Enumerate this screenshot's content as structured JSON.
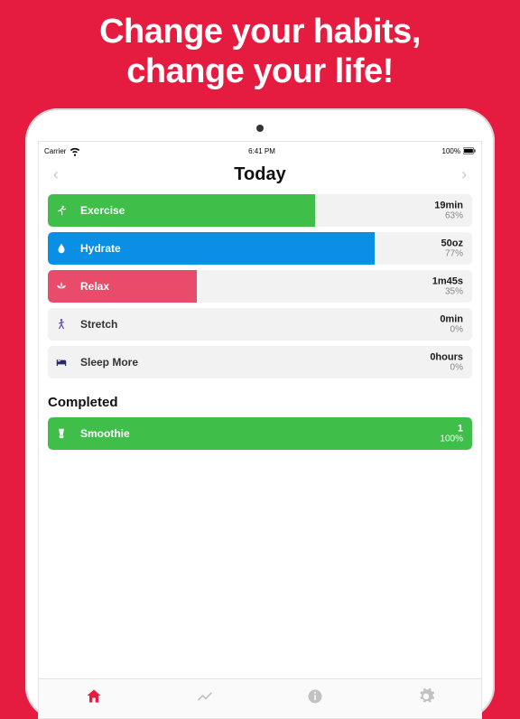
{
  "promo": {
    "headline_l1": "Change your habits,",
    "headline_l2": "change your life!"
  },
  "status": {
    "carrier": "Carrier",
    "time": "6:41 PM",
    "battery": "100%"
  },
  "header": {
    "title": "Today"
  },
  "habits": [
    {
      "id": "exercise",
      "label": "Exercise",
      "value": "19min",
      "percent": "63%",
      "progress": 63,
      "color": "#3fbf4a",
      "icon": "runner-icon",
      "text_on_fill": true
    },
    {
      "id": "hydrate",
      "label": "Hydrate",
      "value": "50oz",
      "percent": "77%",
      "progress": 77,
      "color": "#0a8fe6",
      "icon": "drop-icon",
      "text_on_fill": true
    },
    {
      "id": "relax",
      "label": "Relax",
      "value": "1m45s",
      "percent": "35%",
      "progress": 35,
      "color": "#e94b6a",
      "icon": "lotus-icon",
      "text_on_fill": true
    },
    {
      "id": "stretch",
      "label": "Stretch",
      "value": "0min",
      "percent": "0%",
      "progress": 0,
      "color": "#5b3fb0",
      "icon": "stretch-icon",
      "text_on_fill": false
    },
    {
      "id": "sleepmore",
      "label": "Sleep More",
      "value": "0hours",
      "percent": "0%",
      "progress": 0,
      "color": "#2b2670",
      "icon": "bed-icon",
      "text_on_fill": false
    }
  ],
  "completed_title": "Completed",
  "completed": [
    {
      "id": "smoothie",
      "label": "Smoothie",
      "value": "1",
      "percent": "100%",
      "progress": 100,
      "color": "#3fbf4a",
      "icon": "blender-icon"
    }
  ],
  "tabs": [
    {
      "id": "home",
      "icon": "home-icon",
      "active": true
    },
    {
      "id": "trends",
      "icon": "trend-icon",
      "active": false
    },
    {
      "id": "info",
      "icon": "info-icon",
      "active": false
    },
    {
      "id": "settings",
      "icon": "gear-icon",
      "active": false
    }
  ]
}
